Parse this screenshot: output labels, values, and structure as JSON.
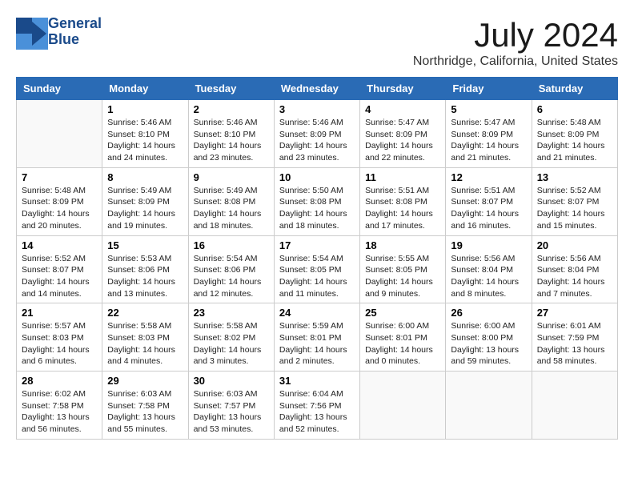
{
  "logo": {
    "line1": "General",
    "line2": "Blue"
  },
  "title": "July 2024",
  "location": "Northridge, California, United States",
  "weekdays": [
    "Sunday",
    "Monday",
    "Tuesday",
    "Wednesday",
    "Thursday",
    "Friday",
    "Saturday"
  ],
  "weeks": [
    [
      {
        "day": "",
        "info": ""
      },
      {
        "day": "1",
        "info": "Sunrise: 5:46 AM\nSunset: 8:10 PM\nDaylight: 14 hours\nand 24 minutes."
      },
      {
        "day": "2",
        "info": "Sunrise: 5:46 AM\nSunset: 8:10 PM\nDaylight: 14 hours\nand 23 minutes."
      },
      {
        "day": "3",
        "info": "Sunrise: 5:46 AM\nSunset: 8:09 PM\nDaylight: 14 hours\nand 23 minutes."
      },
      {
        "day": "4",
        "info": "Sunrise: 5:47 AM\nSunset: 8:09 PM\nDaylight: 14 hours\nand 22 minutes."
      },
      {
        "day": "5",
        "info": "Sunrise: 5:47 AM\nSunset: 8:09 PM\nDaylight: 14 hours\nand 21 minutes."
      },
      {
        "day": "6",
        "info": "Sunrise: 5:48 AM\nSunset: 8:09 PM\nDaylight: 14 hours\nand 21 minutes."
      }
    ],
    [
      {
        "day": "7",
        "info": "Sunrise: 5:48 AM\nSunset: 8:09 PM\nDaylight: 14 hours\nand 20 minutes."
      },
      {
        "day": "8",
        "info": "Sunrise: 5:49 AM\nSunset: 8:09 PM\nDaylight: 14 hours\nand 19 minutes."
      },
      {
        "day": "9",
        "info": "Sunrise: 5:49 AM\nSunset: 8:08 PM\nDaylight: 14 hours\nand 18 minutes."
      },
      {
        "day": "10",
        "info": "Sunrise: 5:50 AM\nSunset: 8:08 PM\nDaylight: 14 hours\nand 18 minutes."
      },
      {
        "day": "11",
        "info": "Sunrise: 5:51 AM\nSunset: 8:08 PM\nDaylight: 14 hours\nand 17 minutes."
      },
      {
        "day": "12",
        "info": "Sunrise: 5:51 AM\nSunset: 8:07 PM\nDaylight: 14 hours\nand 16 minutes."
      },
      {
        "day": "13",
        "info": "Sunrise: 5:52 AM\nSunset: 8:07 PM\nDaylight: 14 hours\nand 15 minutes."
      }
    ],
    [
      {
        "day": "14",
        "info": "Sunrise: 5:52 AM\nSunset: 8:07 PM\nDaylight: 14 hours\nand 14 minutes."
      },
      {
        "day": "15",
        "info": "Sunrise: 5:53 AM\nSunset: 8:06 PM\nDaylight: 14 hours\nand 13 minutes."
      },
      {
        "day": "16",
        "info": "Sunrise: 5:54 AM\nSunset: 8:06 PM\nDaylight: 14 hours\nand 12 minutes."
      },
      {
        "day": "17",
        "info": "Sunrise: 5:54 AM\nSunset: 8:05 PM\nDaylight: 14 hours\nand 11 minutes."
      },
      {
        "day": "18",
        "info": "Sunrise: 5:55 AM\nSunset: 8:05 PM\nDaylight: 14 hours\nand 9 minutes."
      },
      {
        "day": "19",
        "info": "Sunrise: 5:56 AM\nSunset: 8:04 PM\nDaylight: 14 hours\nand 8 minutes."
      },
      {
        "day": "20",
        "info": "Sunrise: 5:56 AM\nSunset: 8:04 PM\nDaylight: 14 hours\nand 7 minutes."
      }
    ],
    [
      {
        "day": "21",
        "info": "Sunrise: 5:57 AM\nSunset: 8:03 PM\nDaylight: 14 hours\nand 6 minutes."
      },
      {
        "day": "22",
        "info": "Sunrise: 5:58 AM\nSunset: 8:03 PM\nDaylight: 14 hours\nand 4 minutes."
      },
      {
        "day": "23",
        "info": "Sunrise: 5:58 AM\nSunset: 8:02 PM\nDaylight: 14 hours\nand 3 minutes."
      },
      {
        "day": "24",
        "info": "Sunrise: 5:59 AM\nSunset: 8:01 PM\nDaylight: 14 hours\nand 2 minutes."
      },
      {
        "day": "25",
        "info": "Sunrise: 6:00 AM\nSunset: 8:01 PM\nDaylight: 14 hours\nand 0 minutes."
      },
      {
        "day": "26",
        "info": "Sunrise: 6:00 AM\nSunset: 8:00 PM\nDaylight: 13 hours\nand 59 minutes."
      },
      {
        "day": "27",
        "info": "Sunrise: 6:01 AM\nSunset: 7:59 PM\nDaylight: 13 hours\nand 58 minutes."
      }
    ],
    [
      {
        "day": "28",
        "info": "Sunrise: 6:02 AM\nSunset: 7:58 PM\nDaylight: 13 hours\nand 56 minutes."
      },
      {
        "day": "29",
        "info": "Sunrise: 6:03 AM\nSunset: 7:58 PM\nDaylight: 13 hours\nand 55 minutes."
      },
      {
        "day": "30",
        "info": "Sunrise: 6:03 AM\nSunset: 7:57 PM\nDaylight: 13 hours\nand 53 minutes."
      },
      {
        "day": "31",
        "info": "Sunrise: 6:04 AM\nSunset: 7:56 PM\nDaylight: 13 hours\nand 52 minutes."
      },
      {
        "day": "",
        "info": ""
      },
      {
        "day": "",
        "info": ""
      },
      {
        "day": "",
        "info": ""
      }
    ]
  ]
}
